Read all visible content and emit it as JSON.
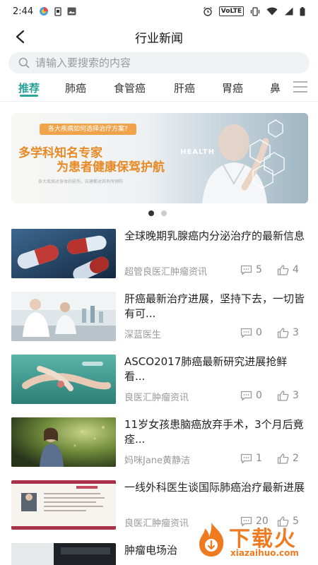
{
  "status": {
    "time": "2:44",
    "network": "VoLTE"
  },
  "header": {
    "title": "行业新闻"
  },
  "search": {
    "placeholder": "请输入要搜索的内容"
  },
  "tabs": [
    "推荐",
    "肺癌",
    "食管癌",
    "肝癌",
    "胃癌",
    "鼻"
  ],
  "banner": {
    "tagline": "各大疾病如何选择治疗方案?",
    "headline_1": "多学科知名专家",
    "headline_2": "为患者健康保驾护航",
    "small_text": "各大疾病对身体的损伤，应建都对其有所预防",
    "graphic_text": "HEALTH",
    "page_count": 2,
    "active_page": 1
  },
  "news": [
    {
      "title": "全球晚期乳腺癌内分泌治疗的最新信息",
      "source": "超管良医汇肿瘤资讯",
      "comments": "5",
      "likes": "4"
    },
    {
      "title": "肝癌最新治疗进展，坚持下去，一切皆有可...",
      "source": "深蓝医生",
      "comments": "0",
      "likes": "3"
    },
    {
      "title": "ASCO2017肺癌最新研究进展抢鲜看...",
      "source": "良医汇肿瘤资讯",
      "comments": "0",
      "likes": "3"
    },
    {
      "title": "11岁女孩患脑癌放弃手术，3个月后竟痊...",
      "source": "妈咪Jane黄静洁",
      "comments": "1",
      "likes": "2"
    },
    {
      "title": "一线外科医生谈国际肺癌治疗最新进展",
      "source": "良医汇肿瘤资讯",
      "comments": "20",
      "likes": "5"
    },
    {
      "title": "肿瘤电场治"
    }
  ],
  "watermark": {
    "text": "下载火",
    "url": "xiazaihuo.com"
  },
  "colors": {
    "accent": "#2aa39a",
    "banner_orange": "#e78a25",
    "watermark": "#f07a20"
  }
}
